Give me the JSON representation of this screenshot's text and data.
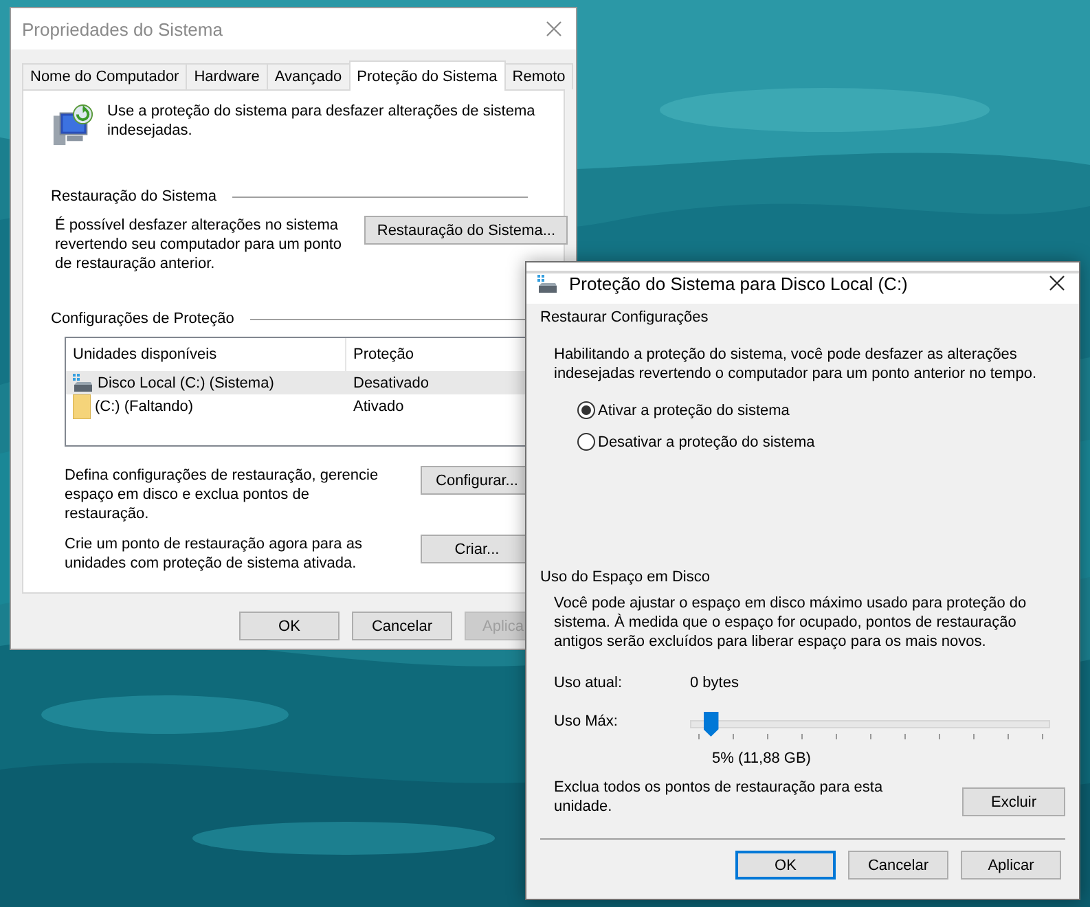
{
  "system_properties": {
    "title": "Propriedades do Sistema",
    "tabs": [
      {
        "label": "Nome do Computador",
        "selected": false
      },
      {
        "label": "Hardware",
        "selected": false
      },
      {
        "label": "Avançado",
        "selected": false
      },
      {
        "label": "Proteção do Sistema",
        "selected": true
      },
      {
        "label": "Remoto",
        "selected": false
      }
    ],
    "intro": "Use a proteção do sistema para desfazer alterações de sistema indesejadas.",
    "restore_heading": "Restauração do Sistema",
    "restore_text": "É possível desfazer alterações no sistema revertendo seu computador para um ponto de restauração anterior.",
    "restore_button": "Restauração do Sistema...",
    "protection_heading": "Configurações de Proteção",
    "columns": [
      "Unidades disponíveis",
      "Proteção"
    ],
    "rows": [
      {
        "kind": "drive",
        "drive": "Disco Local (C:) (Sistema)",
        "protection": "Desativado",
        "selected": true
      },
      {
        "kind": "folder",
        "drive": "(C:) (Faltando)",
        "protection": "Ativado",
        "selected": false
      }
    ],
    "configure_text": "Defina configurações de restauração, gerencie espaço em disco e exclua pontos de restauração.",
    "configure_button": "Configurar...",
    "create_text": "Crie um ponto de restauração agora para as unidades com proteção de sistema ativada.",
    "create_button": "Criar...",
    "buttons": [
      {
        "label": "OK",
        "disabled": false
      },
      {
        "label": "Cancelar",
        "disabled": false
      },
      {
        "label": "Aplica",
        "disabled": true
      }
    ]
  },
  "drive_protection": {
    "title": "Proteção do Sistema para Disco Local (C:)",
    "restore_heading": "Restaurar Configurações",
    "restore_text": "Habilitando a proteção do sistema, você pode desfazer as alterações indesejadas revertendo o computador para um ponto anterior no tempo.",
    "options": [
      {
        "label": "Ativar a proteção do sistema",
        "selected": true
      },
      {
        "label": "Desativar a proteção do sistema",
        "selected": false
      }
    ],
    "usage_heading": "Uso do Espaço em Disco",
    "usage_text": "Você pode ajustar o espaço em disco máximo usado para proteção do sistema. À medida que o espaço for ocupado, pontos de restauração antigos serão excluídos para liberar espaço para os mais novos.",
    "current_label": "Uso atual:",
    "current_value": "0 bytes",
    "max_label": "Uso Máx:",
    "max_slider": {
      "level": 0.06
    },
    "max_reading": "5% (11,88 GB)",
    "delete_text": "Exclua todos os pontos de restauração para esta unidade.",
    "delete_button": "Excluir",
    "buttons": [
      {
        "label": "OK",
        "default": true
      },
      {
        "label": "Cancelar",
        "default": false
      },
      {
        "label": "Aplicar",
        "default": false
      }
    ]
  }
}
